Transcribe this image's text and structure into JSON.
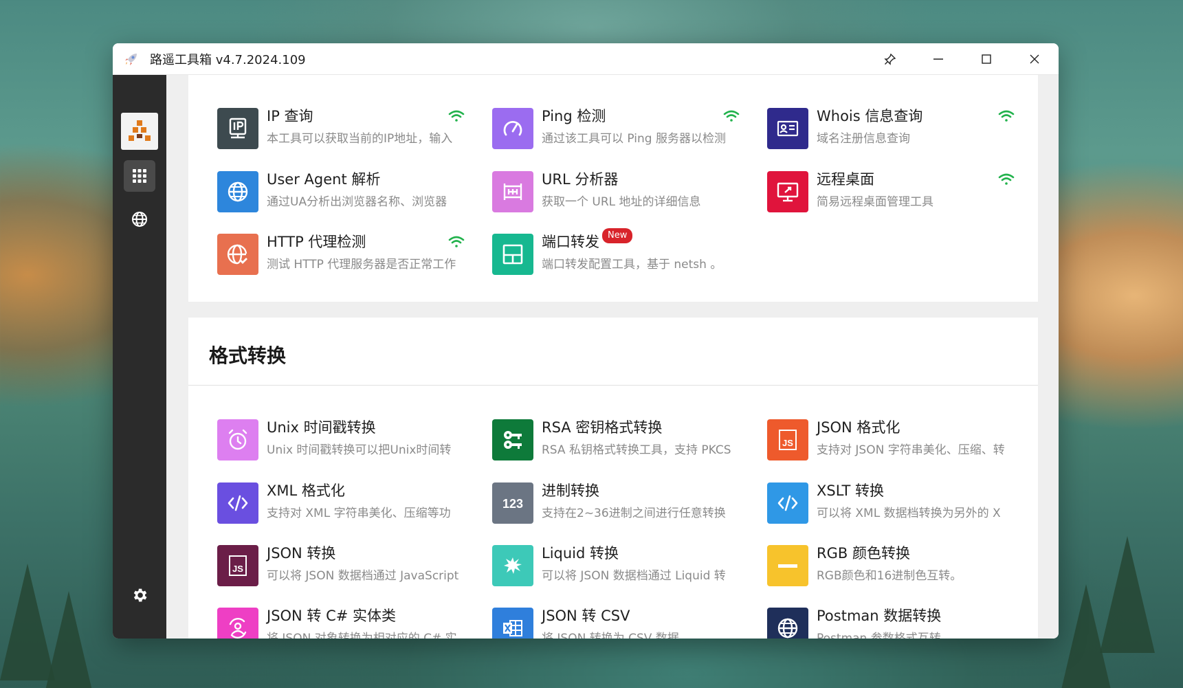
{
  "window": {
    "title": "路遥工具箱 v4.7.2024.109"
  },
  "network_tools": [
    {
      "name": "IP 查询",
      "desc": "本工具可以获取当前的IP地址，输入",
      "icon": "ip-icon",
      "color": "#3d4a4f",
      "wifi": true,
      "badge": ""
    },
    {
      "name": "Ping 检测",
      "desc": "通过该工具可以 Ping 服务器以检测",
      "icon": "gauge-icon",
      "color": "#9b6cf0",
      "wifi": true,
      "badge": ""
    },
    {
      "name": "Whois 信息查询",
      "desc": "域名注册信息查询",
      "icon": "id-card-icon",
      "color": "#2f2a8c",
      "wifi": true,
      "badge": ""
    },
    {
      "name": "User Agent 解析",
      "desc": "通过UA分析出浏览器名称、浏览器",
      "icon": "globe-icon",
      "color": "#2d86dc",
      "wifi": false,
      "badge": ""
    },
    {
      "name": "URL 分析器",
      "desc": "获取一个 URL 地址的详细信息",
      "icon": "frame-icon",
      "color": "#d97ae0",
      "wifi": false,
      "badge": ""
    },
    {
      "name": "远程桌面",
      "desc": "简易远程桌面管理工具",
      "icon": "remote-desktop-icon",
      "color": "#e0143c",
      "wifi": true,
      "badge": ""
    },
    {
      "name": "HTTP 代理检测",
      "desc": "测试 HTTP 代理服务器是否正常工作",
      "icon": "globe-check-icon",
      "color": "#e8704f",
      "wifi": true,
      "badge": ""
    },
    {
      "name": "端口转发",
      "desc": "端口转发配置工具，基于 netsh 。",
      "icon": "layout-icon",
      "color": "#17b890",
      "wifi": false,
      "badge": "New"
    }
  ],
  "format_section": {
    "title": "格式转换",
    "tools": [
      {
        "name": "Unix 时间戳转换",
        "desc": "Unix 时间戳转换可以把Unix时间转",
        "icon": "alarm-clock-icon",
        "color": "#dd7ff0"
      },
      {
        "name": "RSA 密钥格式转换",
        "desc": "RSA 私钥格式转换工具，支持 PKCS",
        "icon": "key-icon",
        "color": "#0e7a3a"
      },
      {
        "name": "JSON 格式化",
        "desc": "支持对 JSON 字符串美化、压缩、转",
        "icon": "js-icon",
        "color": "#ee5a2c"
      },
      {
        "name": "XML 格式化",
        "desc": "支持对 XML 字符串美化、压缩等功",
        "icon": "code-icon",
        "color": "#6a4fe0"
      },
      {
        "name": "进制转换",
        "desc": "支持在2~36进制之间进行任意转换",
        "icon": "numbers-icon",
        "color": "#6b7583"
      },
      {
        "name": "XSLT 转换",
        "desc": "可以将 XML 数据档转换为另外的 X",
        "icon": "code-icon",
        "color": "#2f98e6"
      },
      {
        "name": "JSON 转换",
        "desc": "可以将 JSON 数据档通过 JavaScript",
        "icon": "js-icon",
        "color": "#6b1e48"
      },
      {
        "name": "Liquid 转换",
        "desc": "可以将 JSON 数据档通过 Liquid 转",
        "icon": "splash-icon",
        "color": "#3dc9b8"
      },
      {
        "name": "RGB 颜色转换",
        "desc": "RGB颜色和16进制色互转。",
        "icon": "minus-icon",
        "color": "#f7c32c"
      },
      {
        "name": "JSON 转 C# 实体类",
        "desc": "将 JSON 对象转换为相对应的 C# 实",
        "icon": "user-sync-icon",
        "color": "#ee3fc4"
      },
      {
        "name": "JSON 转 CSV",
        "desc": "将 JSON 转换为 CSV 数据",
        "icon": "excel-icon",
        "color": "#2f7fdc"
      },
      {
        "name": "Postman 数据转换",
        "desc": "Postman 参数格式互转",
        "icon": "globe-icon",
        "color": "#1f2f5a"
      }
    ]
  }
}
